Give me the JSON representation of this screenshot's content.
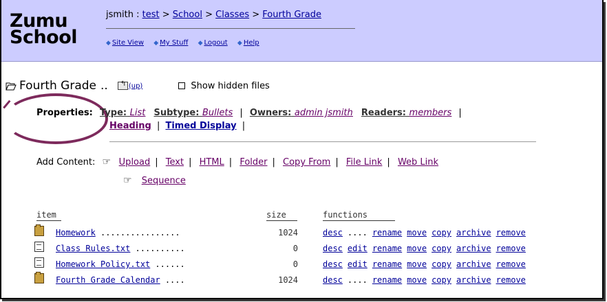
{
  "header": {
    "logo_line1": "Zumu",
    "logo_line2": "School",
    "user": "jsmith",
    "crumb_sep": " : ",
    "breadcrumbs": [
      "test",
      "School",
      "Classes",
      "Fourth Grade"
    ],
    "nav": [
      "Site View",
      "My Stuff",
      "Logout",
      "Help"
    ]
  },
  "folder": {
    "title": "Fourth Grade",
    "dots": "..",
    "up_label": "(up)",
    "show_hidden_label": "Show hidden files",
    "show_hidden_checked": false
  },
  "properties": {
    "label": "Properties:",
    "type_label": "Type:",
    "type_value": "List",
    "subtype_label": "Subtype:",
    "subtype_value": "Bullets",
    "owners_label": "Owners:",
    "owners_value": "admin jsmith",
    "readers_label": "Readers:",
    "readers_value": "members",
    "heading": "Heading",
    "timed_display": "Timed Display"
  },
  "add_content": {
    "label": "Add Content:",
    "links": [
      "Upload",
      "Text",
      "HTML",
      "Folder",
      "Copy From",
      "File Link",
      "Web Link"
    ],
    "second_row": "Sequence"
  },
  "table": {
    "headers": {
      "item": "item",
      "size": "size",
      "functions": "functions"
    },
    "rows": [
      {
        "icon": "folder-icon",
        "name": "Homework",
        "lead": "................",
        "size": "1024",
        "functions": [
          "desc",
          "....",
          "rename",
          "move",
          "copy",
          "archive",
          "remove"
        ]
      },
      {
        "icon": "document-icon",
        "name": "Class Rules.txt",
        "lead": "..........",
        "size": "0",
        "functions": [
          "desc",
          "edit",
          "rename",
          "move",
          "copy",
          "archive",
          "remove"
        ]
      },
      {
        "icon": "document-icon",
        "name": "Homework Policy.txt",
        "lead": "......",
        "size": "0",
        "functions": [
          "desc",
          "edit",
          "rename",
          "move",
          "copy",
          "archive",
          "remove"
        ]
      },
      {
        "icon": "folder-icon",
        "name": "Fourth Grade Calendar",
        "lead": "....",
        "size": "1024",
        "functions": [
          "desc",
          "....",
          "rename",
          "move",
          "copy",
          "archive",
          "remove"
        ]
      }
    ]
  },
  "colors": {
    "header_bg": "#ccccff",
    "link": "#000099",
    "visited": "#660066",
    "annotation_circle": "#7d2a5c"
  }
}
